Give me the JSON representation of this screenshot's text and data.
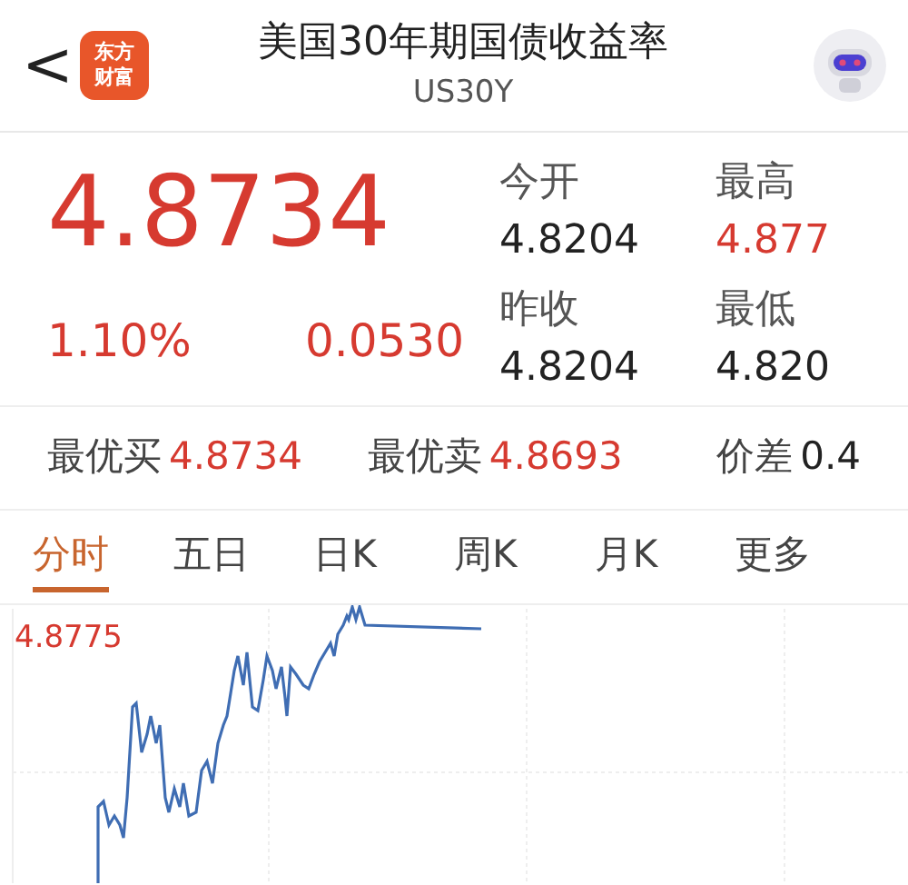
{
  "header": {
    "back": "<",
    "logo": {
      "lines": [
        "东方",
        "财富"
      ]
    },
    "title": "美国30年期国债收益率",
    "code": "US30Y"
  },
  "quote": {
    "price": "4.8734",
    "change_pct": "1.10%",
    "change": "0.0530"
  },
  "stats": [
    {
      "label": "今开",
      "value": "4.8204",
      "up": false
    },
    {
      "label": "最高",
      "value": "4.877",
      "up": true
    },
    {
      "label": "昨收",
      "value": "4.8204",
      "up": false
    },
    {
      "label": "最低",
      "value": "4.820",
      "up": false
    }
  ],
  "book": [
    {
      "label": "最优买",
      "value": "4.8734",
      "up": true
    },
    {
      "label": "最优卖",
      "value": "4.8693",
      "up": true
    },
    {
      "label": "价差",
      "value": "0.4",
      "up": false
    }
  ],
  "tabs": [
    {
      "label": "分时",
      "selected": true
    },
    {
      "label": "五日",
      "selected": false
    },
    {
      "label": "日K",
      "selected": false
    },
    {
      "label": "周K",
      "selected": false
    },
    {
      "label": "月K",
      "selected": false
    },
    {
      "label": "更多",
      "selected": false
    }
  ],
  "chart": {
    "high_label": "4.8775"
  }
}
